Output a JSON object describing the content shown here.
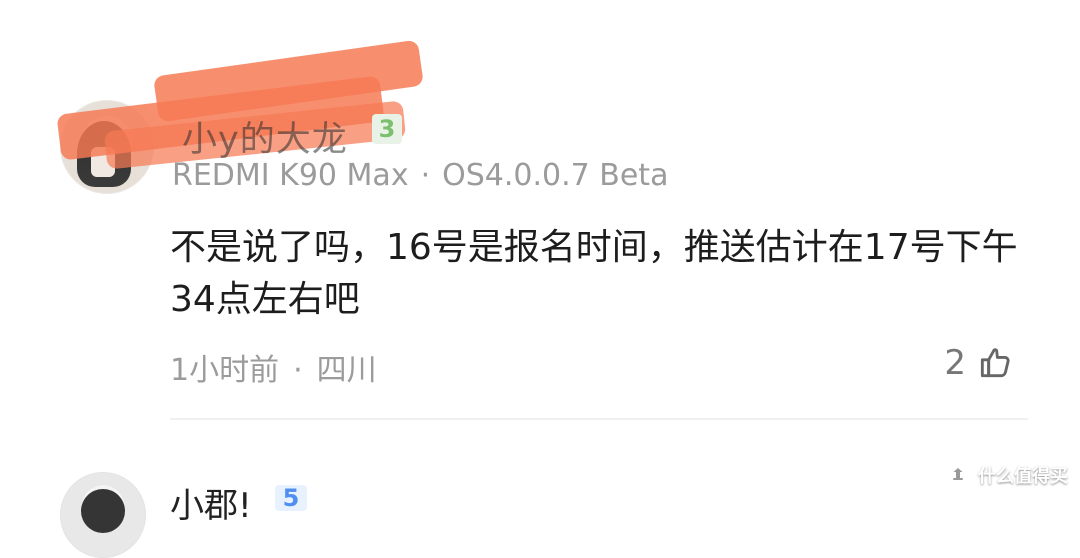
{
  "comments": [
    {
      "username": "小y的大龙",
      "level": "3",
      "device": "REDMI K90 Max",
      "os": "OS4.0.0.7 Beta",
      "device_separator": "·",
      "text": "不是说了吗，16号是报名时间，推送估计在17号下午34点左右吧",
      "time": "1小时前",
      "location_separator": "·",
      "location": "四川",
      "likes": "2",
      "avatar_icon": "user-avatar-icon",
      "like_icon": "thumbs-up-icon"
    },
    {
      "username": "小郡!",
      "level": "5",
      "avatar_icon": "user-avatar-icon"
    }
  ],
  "watermark": {
    "text": "什么值得买",
    "icon": "watermark-logo-icon"
  },
  "colors": {
    "redaction": "#f67a54",
    "meta_text": "#9b9b9b",
    "level_green": "#7cc06d",
    "level_blue": "#4f8ff1",
    "divider": "#f0f0f0"
  }
}
